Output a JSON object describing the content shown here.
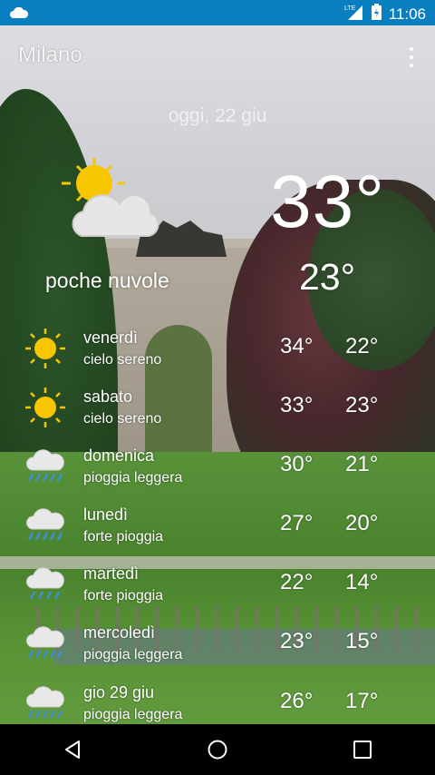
{
  "status_bar": {
    "time": "11:06",
    "network": "LTE",
    "notification_icon": "cloud-icon"
  },
  "header": {
    "city": "Milano",
    "date": "oggi, 22 giu"
  },
  "current": {
    "temperature": "33°",
    "low": "23°",
    "condition": "poche nuvole",
    "icon": "sun-cloud-icon"
  },
  "forecast": [
    {
      "day": "venerdì",
      "condition": "cielo sereno",
      "high": "34°",
      "low": "22°",
      "icon": "sun-icon"
    },
    {
      "day": "sabato",
      "condition": "cielo sereno",
      "high": "33°",
      "low": "23°",
      "icon": "sun-icon"
    },
    {
      "day": "domenica",
      "condition": "pioggia leggera",
      "high": "30°",
      "low": "21°",
      "icon": "rain-cloud-icon"
    },
    {
      "day": "lunedì",
      "condition": "forte pioggia",
      "high": "27°",
      "low": "20°",
      "icon": "rain-cloud-icon"
    },
    {
      "day": "martedì",
      "condition": "forte pioggia",
      "high": "22°",
      "low": "14°",
      "icon": "rain-cloud-icon"
    },
    {
      "day": "mercoledì",
      "condition": "pioggia leggera",
      "high": "23°",
      "low": "15°",
      "icon": "rain-cloud-icon"
    },
    {
      "day": "gio 29 giu",
      "condition": "pioggia leggera",
      "high": "26°",
      "low": "17°",
      "icon": "rain-cloud-icon"
    }
  ],
  "colors": {
    "status_bar": "#0a7fc0",
    "sun": "#f7c600",
    "rain": "#3d8fd6"
  }
}
